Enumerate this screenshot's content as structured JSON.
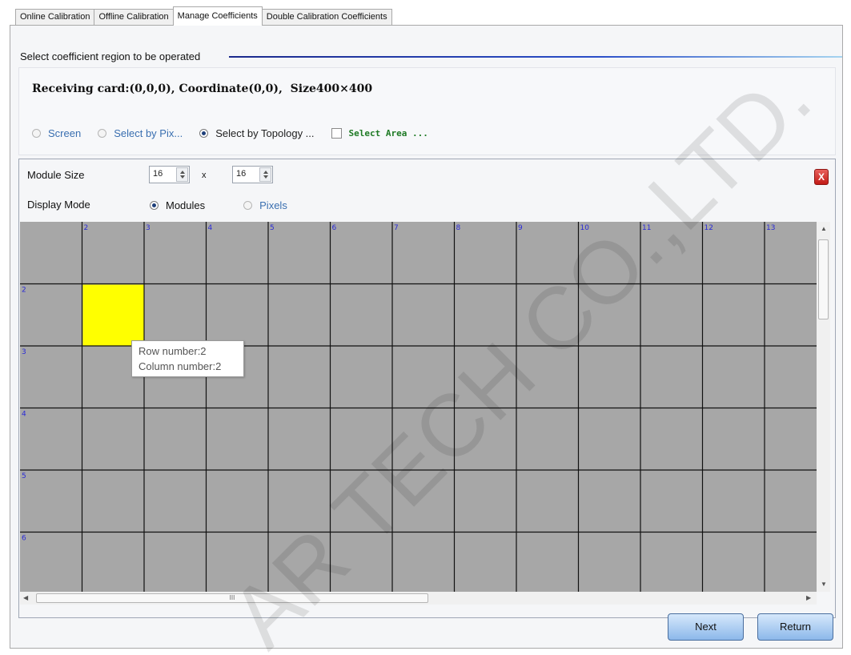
{
  "tabs": [
    {
      "label": "Online Calibration"
    },
    {
      "label": "Offline Calibration"
    },
    {
      "label": "Manage Coefficients",
      "active": true
    },
    {
      "label": "Double Calibration Coefficients"
    }
  ],
  "section": {
    "title": "Select coefficient region to be operated",
    "card_info": "Receiving card:(0,0,0), Coordinate(0,0),  Size400×400"
  },
  "selection": {
    "options": [
      {
        "label": "Screen",
        "selected": false
      },
      {
        "label": "Select by Pix...",
        "selected": false
      },
      {
        "label": "Select by Topology ...",
        "selected": true
      }
    ],
    "select_area_label": "Select Area ...",
    "select_area_checked": false
  },
  "module": {
    "size_label": "Module Size",
    "width_value": "16",
    "x_label": "x",
    "height_value": "16",
    "display_mode_label": "Display Mode",
    "display_modes": [
      {
        "label": "Modules",
        "selected": true
      },
      {
        "label": "Pixels",
        "selected": false
      }
    ],
    "close_label": "X"
  },
  "grid": {
    "column_labels": [
      "2",
      "3",
      "4",
      "5",
      "6",
      "7",
      "8",
      "9",
      "10",
      "11",
      "12",
      "13"
    ],
    "row_labels": [
      "2",
      "3",
      "4",
      "5",
      "6"
    ],
    "highlight_row": 2,
    "highlight_col": 2,
    "cell_color": "#a7a7a7",
    "highlight_color": "#ffff00"
  },
  "tooltip": {
    "row": "Row number:2",
    "column": "Column number:2"
  },
  "buttons": {
    "next": "Next",
    "return": "Return"
  },
  "watermark": "AR TECH CO.,LTD."
}
